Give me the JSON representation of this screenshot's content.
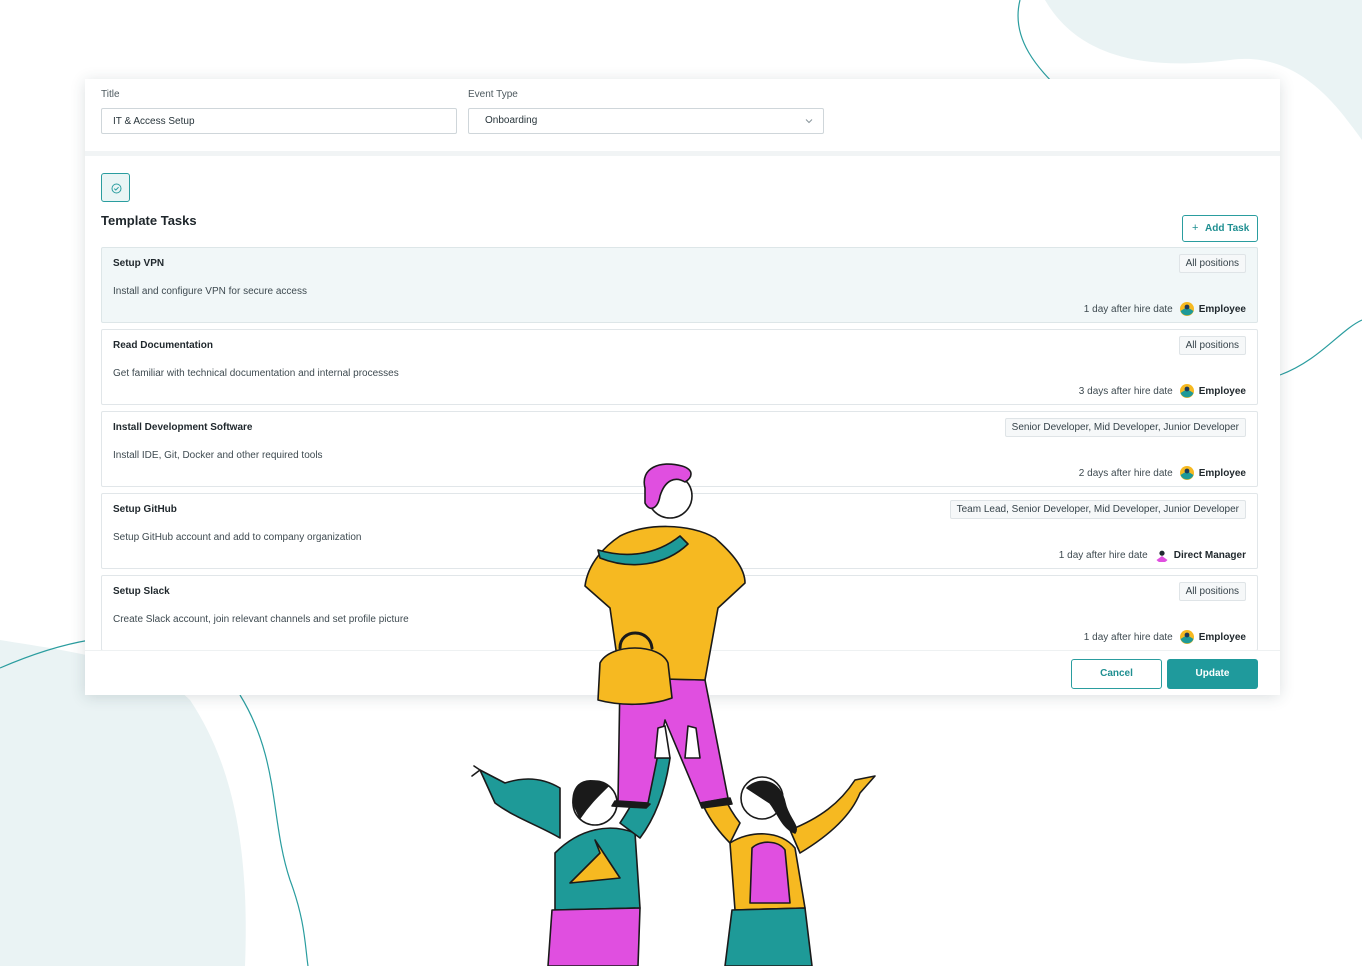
{
  "colors": {
    "accent": "#1f9a9c",
    "background_blob": "#eaf3f4",
    "magenta": "#e04fe0",
    "yellow": "#f6b921",
    "teal": "#1e9a98"
  },
  "form": {
    "title_label": "Title",
    "title_value": "IT & Access Setup",
    "event_type_label": "Event Type",
    "event_type_value": "Onboarding"
  },
  "section": {
    "title": "Template Tasks",
    "add_task_label": "Add Task",
    "check_icon": "check-circle-icon"
  },
  "tasks": [
    {
      "name": "Setup VPN",
      "description": "Install and configure VPN for secure access",
      "positions": "All positions",
      "timing": "1 day after hire date",
      "assignee": "Employee",
      "assignee_icon": "employee-avatar-icon"
    },
    {
      "name": "Read Documentation",
      "description": "Get familiar with technical documentation and internal processes",
      "positions": "All positions",
      "timing": "3 days after hire date",
      "assignee": "Employee",
      "assignee_icon": "employee-avatar-icon"
    },
    {
      "name": "Install Development Software",
      "description": "Install IDE, Git, Docker and other required tools",
      "positions": "Senior Developer, Mid Developer, Junior Developer",
      "timing": "2 days after hire date",
      "assignee": "Employee",
      "assignee_icon": "employee-avatar-icon"
    },
    {
      "name": "Setup GitHub",
      "description": "Setup GitHub account and add to company organization",
      "positions": "Team Lead, Senior Developer, Mid Developer, Junior Developer",
      "timing": "1 day after hire date",
      "assignee": "Direct Manager",
      "assignee_icon": "manager-avatar-icon"
    },
    {
      "name": "Setup Slack",
      "description": "Create Slack account, join relevant channels and set profile picture",
      "positions": "All positions",
      "timing": "1 day after hire date",
      "assignee": "Employee",
      "assignee_icon": "employee-avatar-icon"
    }
  ],
  "footer": {
    "cancel_label": "Cancel",
    "update_label": "Update"
  }
}
